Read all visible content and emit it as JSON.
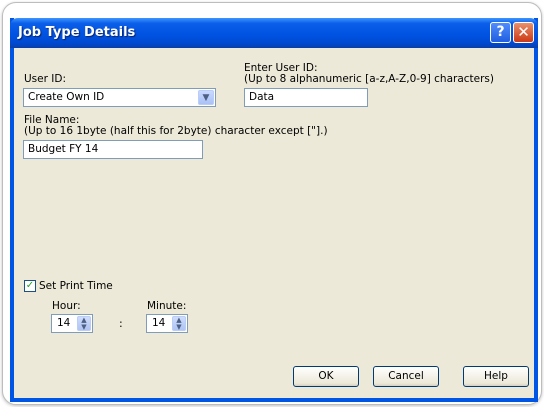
{
  "window": {
    "title": "Job Type Details",
    "help_glyph": "?",
    "close_glyph": "✕"
  },
  "user_id": {
    "label": "User ID:",
    "selected": "Create Own ID"
  },
  "enter_user_id": {
    "label": "Enter User ID:",
    "hint": "(Up to 8 alphanumeric [a-z,A-Z,0-9] characters)",
    "value": "Data"
  },
  "file_name": {
    "label": "File Name:",
    "hint": "(Up to 16 1byte (half this for 2byte) character except [\"].)",
    "value": "Budget FY 14"
  },
  "print_time": {
    "checkbox_label": "Set Print Time",
    "checked": true,
    "hour_label": "Hour:",
    "hour_value": "14",
    "separator": ":",
    "minute_label": "Minute:",
    "minute_value": "14"
  },
  "buttons": {
    "ok": "OK",
    "cancel": "Cancel",
    "help": "Help"
  }
}
